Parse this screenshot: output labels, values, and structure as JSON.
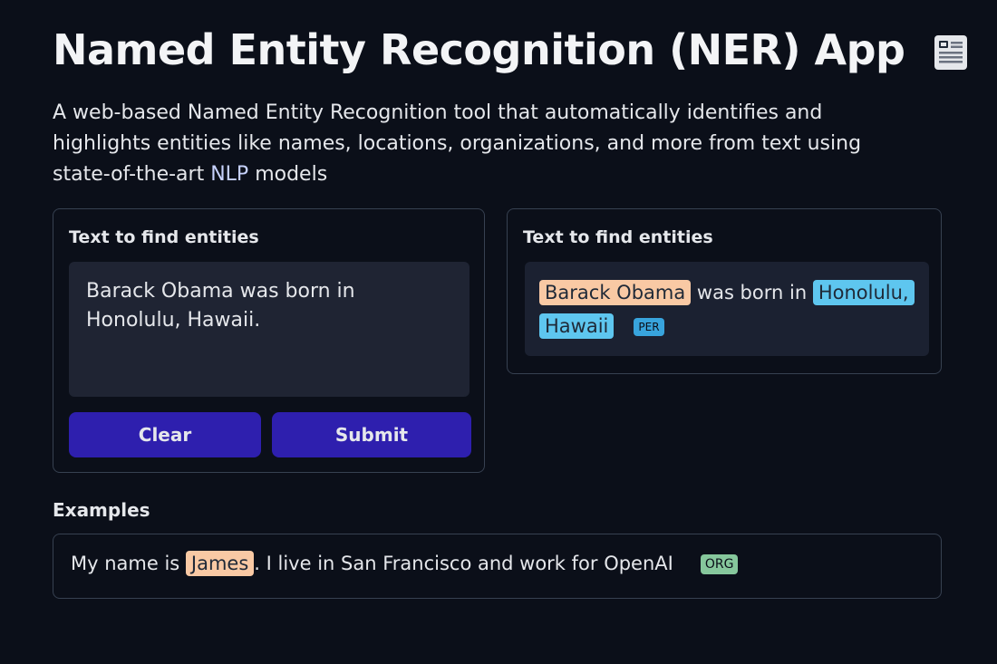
{
  "app": {
    "title": "Named Entity Recognition (NER) App",
    "title_icon": "newspaper-icon",
    "description_before": "A web-based Named Entity Recognition tool that automatically identifies and highlights entities like names, locations, organizations, and more from text using state-of-the-art ",
    "description_highlight": "NLP",
    "description_after": " models"
  },
  "input": {
    "label": "Text to find entities",
    "value": "Barack Obama was born in Honolulu, Hawaii.",
    "clear_label": "Clear",
    "submit_label": "Submit"
  },
  "output": {
    "label": "Text to find entities",
    "segments": {
      "ent1": "Barack Obama",
      "text1": " was born in ",
      "ent2": "Honolulu,",
      "ent3": "Hawaii",
      "tag": "PER"
    }
  },
  "examples": {
    "label": "Examples",
    "item": {
      "text_before": "My name is ",
      "entity": "James",
      "text_after": ". I live in San Francisco and work for OpenAI",
      "tag": "ORG"
    }
  },
  "colors": {
    "background": "#0b0f19",
    "button": "#2e1fae",
    "per_entity": "#f9c9a4",
    "loc_entity": "#5ec6ef",
    "per_tag": "#38a4dd",
    "org_tag": "#86c79c"
  }
}
